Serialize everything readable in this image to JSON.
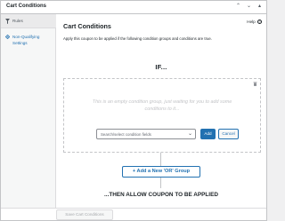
{
  "window": {
    "title": "Cart Conditions",
    "controls": [
      "chevron-up",
      "chevron-down",
      "collapse"
    ]
  },
  "sidebar": {
    "items": [
      {
        "label": "Rules",
        "icon": "funnel-icon",
        "active": true
      },
      {
        "label": "Non-Qualifying Settings",
        "icon": "gear-icon",
        "active": false
      }
    ]
  },
  "main": {
    "heading": "Cart Conditions",
    "help_label": "Help",
    "description": "Apply this coupon to be applied if the following condition groups and conditions are true.",
    "if_label": "IF...",
    "group": {
      "empty_message": "This is an empty condition group, just waiting for you to add some conditions to it...",
      "select_placeholder": "Search/select condition fields",
      "add_label": "Add",
      "cancel_label": "Cancel"
    },
    "or_button_label": "+ Add a New 'OR' Group",
    "then_label": "...THEN ALLOW COUPON TO BE APPLIED"
  },
  "footer": {
    "save_label": "Save Cart Conditions"
  },
  "colors": {
    "accent": "#2271b1",
    "border": "#c3c4c7",
    "sidebar_bg": "#f6f7f7"
  }
}
